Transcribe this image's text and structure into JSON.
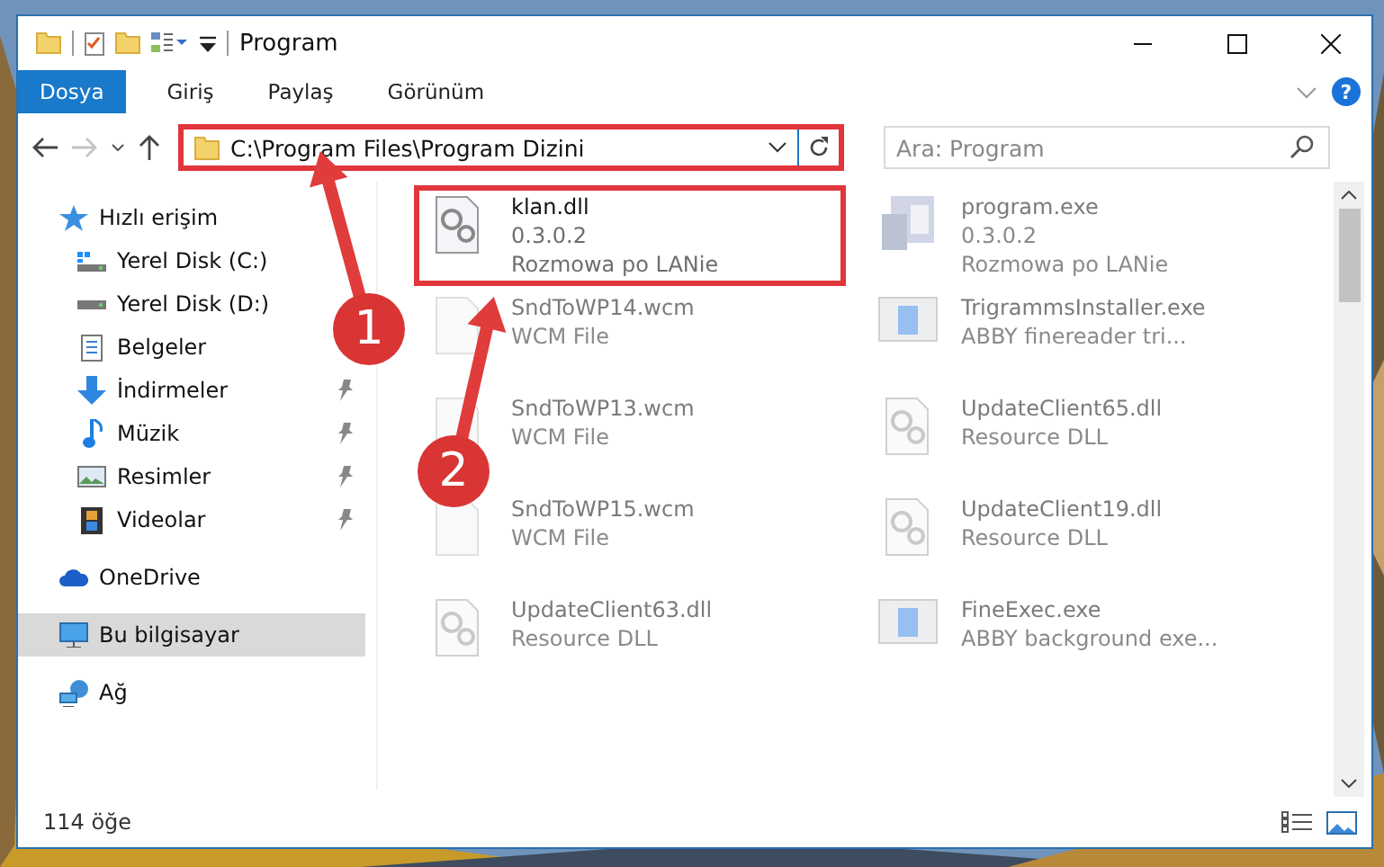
{
  "window": {
    "title": "Program"
  },
  "ribbon": {
    "tabs": [
      {
        "label": "Dosya",
        "kind": "file"
      },
      {
        "label": "Giriş",
        "kind": "tab"
      },
      {
        "label": "Paylaş",
        "kind": "tab"
      },
      {
        "label": "Görünüm",
        "kind": "tab"
      }
    ],
    "help": "?"
  },
  "navigation": {
    "forward_disabled": true,
    "address": "C:\\Program Files\\Program Dizini",
    "address_highlighted": true,
    "search_placeholder": "Ara: Program"
  },
  "sidebar": {
    "items": [
      {
        "label": "Hızlı erişim",
        "kind": "star",
        "selected": false,
        "children": [
          {
            "label": "Yerel Disk (C:)",
            "kind": "system-drive",
            "pinned": false,
            "selected": false
          },
          {
            "label": "Yerel Disk (D:)",
            "kind": "drive",
            "pinned": false,
            "selected": false
          },
          {
            "label": "Belgeler",
            "kind": "documents",
            "pinned": false,
            "selected": false
          },
          {
            "label": "İndirmeler",
            "kind": "downloads",
            "pinned": true,
            "selected": false
          },
          {
            "label": "Müzik",
            "kind": "music",
            "pinned": true,
            "selected": false
          },
          {
            "label": "Resimler",
            "kind": "pictures",
            "pinned": true,
            "selected": false
          },
          {
            "label": "Videolar",
            "kind": "videos",
            "pinned": true,
            "selected": false
          }
        ]
      },
      {
        "label": "OneDrive",
        "kind": "cloud",
        "selected": false
      },
      {
        "label": "Bu bilgisayar",
        "kind": "computer",
        "selected": true
      },
      {
        "label": "Ağ",
        "kind": "network",
        "selected": false
      }
    ]
  },
  "files": [
    {
      "name": "klan.dll",
      "details": [
        "0.3.0.2",
        "Rozmowa po LANie"
      ],
      "kind": "dll",
      "blurred": false,
      "highlighted": true
    },
    {
      "name": "program.exe",
      "details": [
        "0.3.0.2",
        "Rozmowa po LANie"
      ],
      "kind": "app",
      "blurred": true,
      "highlighted": false
    },
    {
      "name": "SndToWP14.wcm",
      "details": [
        "WCM File"
      ],
      "kind": "blank",
      "blurred": true,
      "highlighted": false
    },
    {
      "name": "TrigrammsInstaller.exe",
      "details": [
        "ABBY finereader tri..."
      ],
      "kind": "window",
      "blurred": true,
      "highlighted": false
    },
    {
      "name": "SndToWP13.wcm",
      "details": [
        "WCM File"
      ],
      "kind": "blank",
      "blurred": true,
      "highlighted": false
    },
    {
      "name": "UpdateClient65.dll",
      "details": [
        "Resource DLL"
      ],
      "kind": "dll",
      "blurred": true,
      "highlighted": false
    },
    {
      "name": "SndToWP15.wcm",
      "details": [
        "WCM File"
      ],
      "kind": "blank",
      "blurred": true,
      "highlighted": false
    },
    {
      "name": "UpdateClient19.dll",
      "details": [
        "Resource DLL"
      ],
      "kind": "dll",
      "blurred": true,
      "highlighted": false
    },
    {
      "name": "UpdateClient63.dll",
      "details": [
        "Resource DLL"
      ],
      "kind": "dll",
      "blurred": true,
      "highlighted": false
    },
    {
      "name": "FineExec.exe",
      "details": [
        "ABBY background exe..."
      ],
      "kind": "window",
      "blurred": true,
      "highlighted": false
    }
  ],
  "status_bar": {
    "count": "114 öğe"
  },
  "callouts": [
    {
      "number": "1"
    },
    {
      "number": "2"
    }
  ]
}
